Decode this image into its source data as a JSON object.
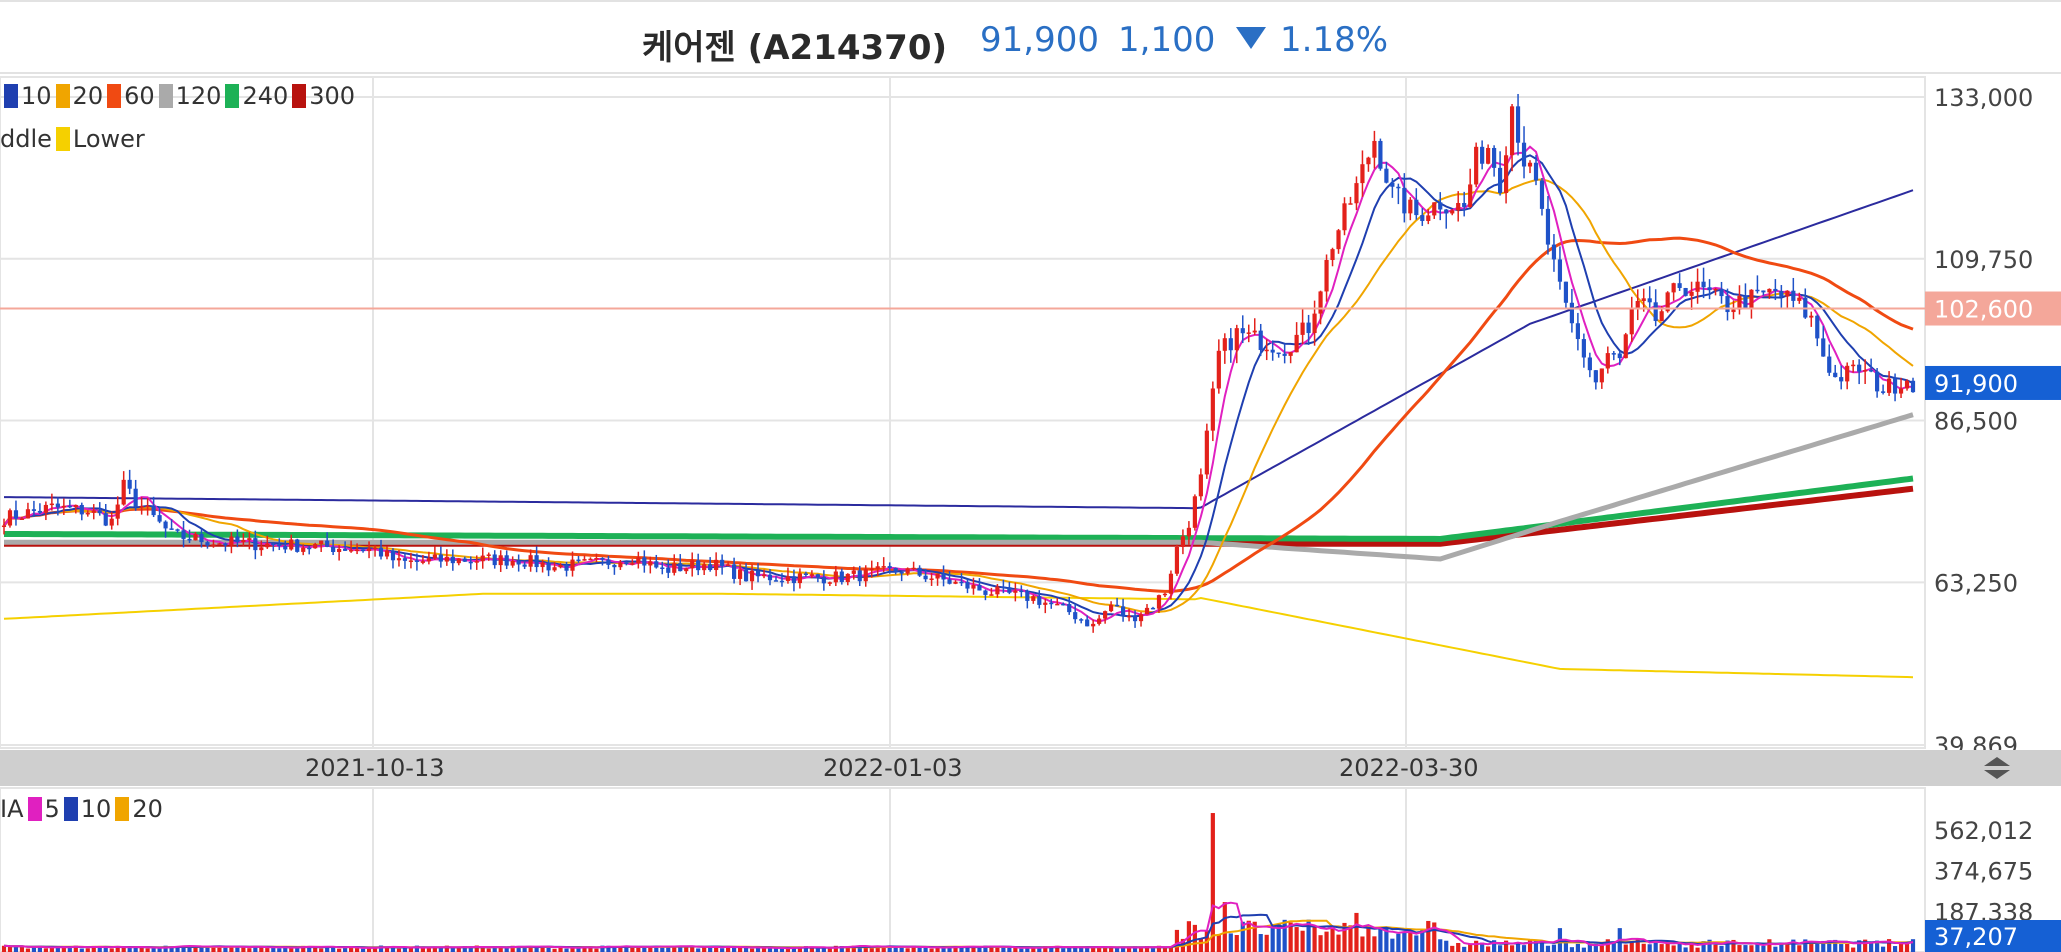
{
  "header": {
    "title": "케어젠 (A214370)",
    "price": "91,900",
    "change": "1,100",
    "change_direction": "down",
    "change_pct": "1.18%",
    "color": "#2a6fc4"
  },
  "legend": {
    "ma_items": [
      {
        "label": "10",
        "color": "#1f3fb0"
      },
      {
        "label": "20",
        "color": "#f0a500"
      },
      {
        "label": "60",
        "color": "#f04a12"
      },
      {
        "label": "120",
        "color": "#aaaaaa"
      },
      {
        "label": "240",
        "color": "#1db156"
      },
      {
        "label": "300",
        "color": "#b8120e"
      }
    ],
    "bb_items": [
      {
        "label": "ddle",
        "color": null
      },
      {
        "label": "Lower",
        "color": "#f5d000"
      }
    ],
    "vol_items": [
      {
        "label": "IA",
        "color": null
      },
      {
        "label": "5",
        "color": "#e020c0"
      },
      {
        "label": "10",
        "color": "#1f3fb0"
      },
      {
        "label": "20",
        "color": "#f0a500"
      }
    ]
  },
  "chart_data": [
    {
      "type": "candlestick",
      "title": "",
      "x_ticks": [
        "2021-10-13",
        "2022-01-03",
        "2022-03-30"
      ],
      "y_ticks": [
        "133,000",
        "109,750",
        "86,500",
        "63,250",
        "39,869"
      ],
      "ylim": [
        39869,
        133000
      ],
      "current_price": {
        "label": "91,900",
        "value": 91900,
        "color": "#1560d4"
      },
      "reference_line": {
        "label": "102,600",
        "value": 102600,
        "color": "#f4a79a"
      },
      "series": [
        {
          "name": "10",
          "color": "#1f3fb0"
        },
        {
          "name": "20",
          "color": "#f0a500"
        },
        {
          "name": "60",
          "color": "#f04a12"
        },
        {
          "name": "120",
          "color": "#aaaaaa"
        },
        {
          "name": "240",
          "color": "#1db156"
        },
        {
          "name": "300",
          "color": "#b8120e"
        },
        {
          "name": "Lower",
          "color": "#f5d000"
        }
      ],
      "price_path": [
        [
          0,
          72500
        ],
        [
          8,
          74000
        ],
        [
          14,
          73500
        ],
        [
          18,
          72000
        ],
        [
          20,
          77000
        ],
        [
          22,
          75000
        ],
        [
          28,
          70000
        ],
        [
          36,
          69000
        ],
        [
          50,
          68500
        ],
        [
          62,
          68000
        ],
        [
          66,
          66000
        ],
        [
          74,
          66500
        ],
        [
          86,
          66500
        ],
        [
          92,
          65500
        ],
        [
          100,
          66000
        ],
        [
          105,
          67000
        ],
        [
          110,
          65000
        ],
        [
          118,
          66000
        ],
        [
          124,
          64000
        ],
        [
          132,
          64000
        ],
        [
          140,
          64000
        ],
        [
          150,
          65000
        ],
        [
          154,
          64200
        ],
        [
          164,
          62000
        ],
        [
          172,
          61000
        ],
        [
          178,
          59000
        ],
        [
          182,
          57000
        ],
        [
          185,
          60000
        ],
        [
          188,
          58000
        ],
        [
          190,
          59000
        ],
        [
          192,
          60000
        ],
        [
          194,
          62000
        ],
        [
          196,
          68000
        ],
        [
          198,
          72000
        ],
        [
          200,
          78000
        ],
        [
          203,
          96000
        ],
        [
          206,
          99000
        ],
        [
          210,
          98000
        ],
        [
          214,
          97000
        ],
        [
          218,
          100000
        ],
        [
          222,
          112000
        ],
        [
          226,
          120000
        ],
        [
          229,
          127000
        ],
        [
          232,
          119000
        ],
        [
          236,
          116000
        ],
        [
          240,
          118000
        ],
        [
          244,
          117000
        ],
        [
          246,
          124000
        ],
        [
          248,
          126000
        ],
        [
          250,
          121000
        ],
        [
          252,
          132000
        ],
        [
          254,
          124000
        ],
        [
          256,
          120000
        ],
        [
          258,
          112000
        ],
        [
          260,
          105000
        ],
        [
          262,
          100000
        ],
        [
          264,
          96000
        ],
        [
          266,
          92000
        ],
        [
          268,
          96000
        ],
        [
          270,
          95000
        ],
        [
          272,
          102000
        ],
        [
          274,
          103000
        ],
        [
          276,
          101000
        ],
        [
          280,
          106000
        ],
        [
          284,
          105000
        ],
        [
          288,
          103000
        ],
        [
          292,
          104000
        ],
        [
          296,
          105000
        ],
        [
          300,
          103000
        ],
        [
          302,
          101000
        ],
        [
          304,
          96000
        ],
        [
          306,
          92500
        ],
        [
          310,
          94000
        ],
        [
          314,
          91000
        ],
        [
          318,
          92500
        ],
        [
          319,
          91900
        ]
      ]
    },
    {
      "type": "bar",
      "title": "",
      "y_ticks": [
        "562,012",
        "374,675",
        "187,338"
      ],
      "current_volume": {
        "label": "37,207",
        "value": 37207,
        "color": "#1560d4"
      },
      "series": [
        {
          "name": "5",
          "color": "#e020c0"
        },
        {
          "name": "10",
          "color": "#1f3fb0"
        },
        {
          "name": "20",
          "color": "#f0a500"
        }
      ]
    }
  ]
}
